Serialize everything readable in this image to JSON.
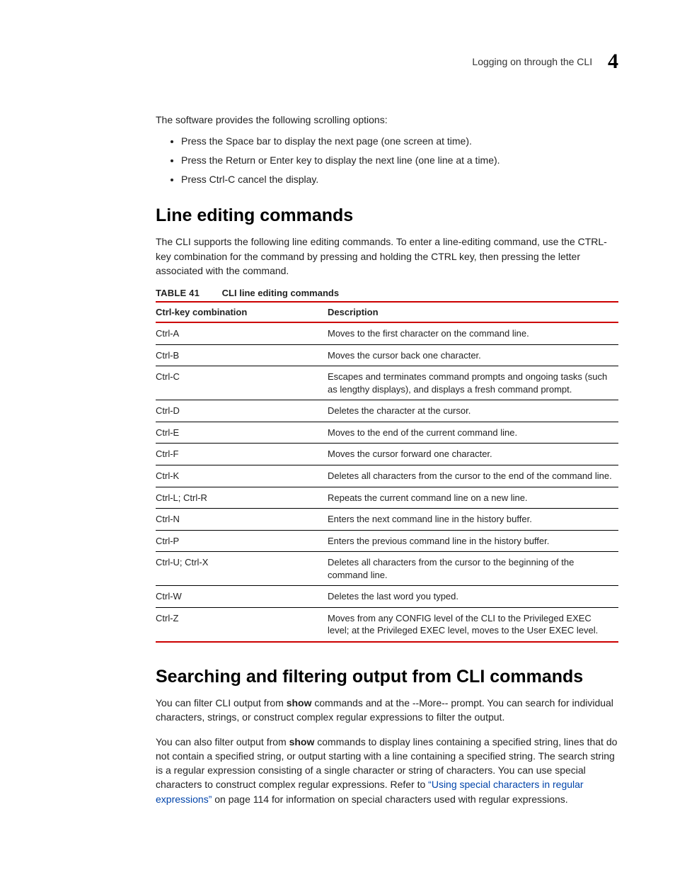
{
  "running_header": {
    "title": "Logging on through the CLI",
    "chapter_number": "4"
  },
  "intro": {
    "lead": "The software provides the following scrolling options:",
    "bullets": [
      "Press the Space bar to display the next page (one screen at time).",
      "Press the Return or Enter key to display the next line (one line at a time).",
      "Press Ctrl-C cancel the display."
    ]
  },
  "section1": {
    "heading": "Line editing commands",
    "para": "The CLI supports the following line editing commands. To enter a line-editing command, use the CTRL-key combination for the command by pressing and holding the CTRL key, then pressing the letter associated with the command."
  },
  "table": {
    "label": "TABLE 41",
    "title": "CLI line editing commands",
    "headers": {
      "col1": "Ctrl-key combination",
      "col2": "Description"
    },
    "rows": [
      {
        "key": "Ctrl-A",
        "desc": "Moves to the first character on the command line."
      },
      {
        "key": "Ctrl-B",
        "desc": "Moves the cursor back one character."
      },
      {
        "key": "Ctrl-C",
        "desc": "Escapes and terminates command prompts and ongoing tasks (such as lengthy displays), and displays a fresh command prompt."
      },
      {
        "key": "Ctrl-D",
        "desc": "Deletes the character at the cursor."
      },
      {
        "key": "Ctrl-E",
        "desc": "Moves to the end of the current command line."
      },
      {
        "key": "Ctrl-F",
        "desc": "Moves the cursor forward one character."
      },
      {
        "key": "Ctrl-K",
        "desc": "Deletes all characters from the cursor to the end of the command line."
      },
      {
        "key": "Ctrl-L; Ctrl-R",
        "desc": "Repeats the current command line on a new line."
      },
      {
        "key": "Ctrl-N",
        "desc": "Enters the next command line in the history buffer."
      },
      {
        "key": "Ctrl-P",
        "desc": "Enters the previous command line in the history buffer."
      },
      {
        "key": "Ctrl-U; Ctrl-X",
        "desc": "Deletes all characters from the cursor to the beginning of the command line."
      },
      {
        "key": "Ctrl-W",
        "desc": "Deletes the last word you typed."
      },
      {
        "key": "Ctrl-Z",
        "desc": "Moves from any CONFIG level of the CLI to the Privileged EXEC level; at the Privileged EXEC level, moves to the User EXEC level."
      }
    ]
  },
  "section2": {
    "heading": "Searching and filtering output from CLI commands",
    "para1_a": "You can filter CLI output from ",
    "para1_show": "show",
    "para1_b": " commands and at the --More-- prompt.  You can search for individual characters, strings, or construct complex regular expressions to filter the output.",
    "para2_a": "You can also filter output from ",
    "para2_show": "show",
    "para2_b": " commands to display lines containing a specified string, lines that do not contain a specified string, or output starting with a line containing a specified string. The search string is a regular expression consisting of a single character or string of characters. You can use special characters to construct complex regular expressions. Refer to ",
    "para2_link": "“Using special characters in regular expressions”",
    "para2_c": " on page 114 for information on special characters used with regular expressions."
  }
}
